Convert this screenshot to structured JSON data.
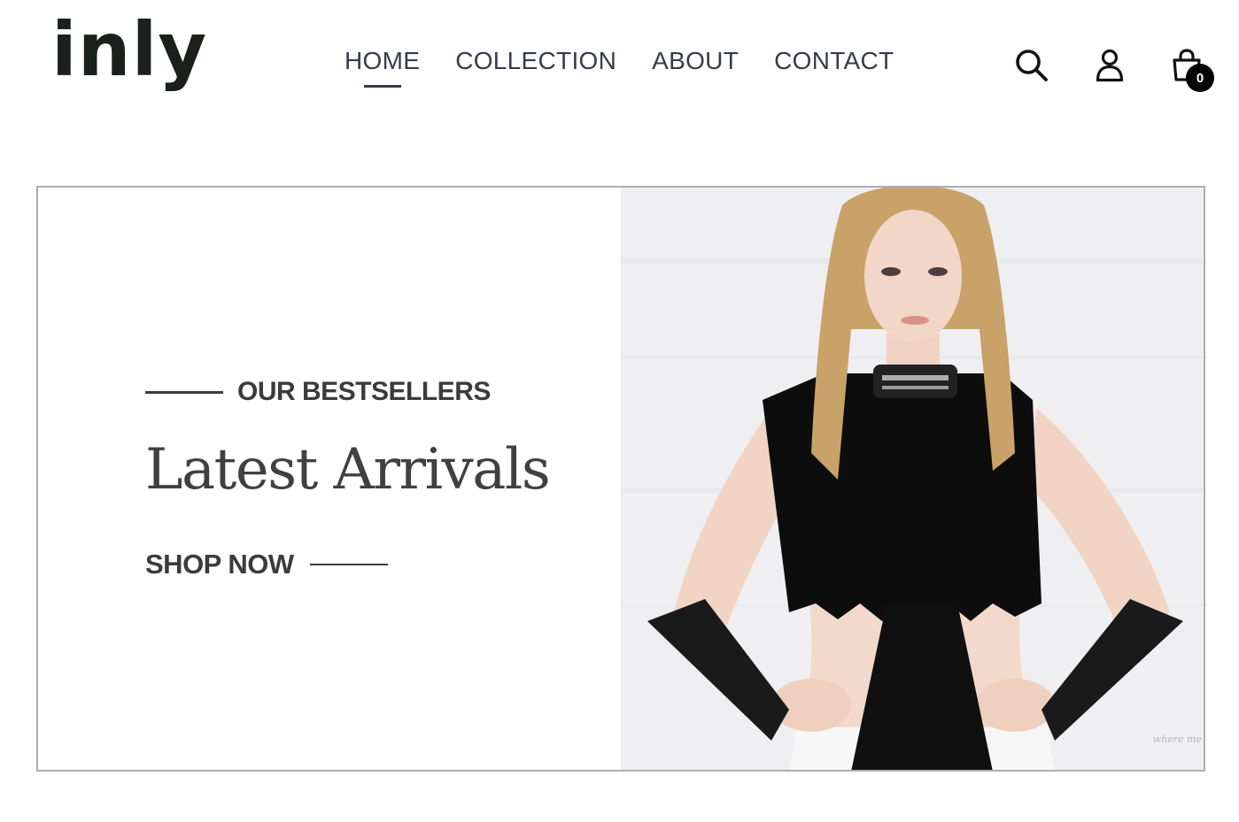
{
  "header": {
    "logo_text": "inly",
    "nav": [
      {
        "label": "HOME",
        "active": true
      },
      {
        "label": "COLLECTION",
        "active": false
      },
      {
        "label": "ABOUT",
        "active": false
      },
      {
        "label": "CONTACT",
        "active": false
      }
    ],
    "icons": {
      "search": "search-icon",
      "account": "user-icon",
      "cart": "shopping-bag-icon"
    },
    "cart_count": "0"
  },
  "hero": {
    "eyebrow": "OUR BESTSELLERS",
    "title": "Latest Arrivals",
    "cta_label": "SHOP NOW",
    "image_alt": "model in black fringed top and long lace gloves",
    "watermark": "where me"
  },
  "colors": {
    "text_dark": "#3b3b3b",
    "nav_text": "#353c4a",
    "logo": "#1b201d",
    "hero_border": "#a8aeb6",
    "badge_bg": "#000000"
  }
}
